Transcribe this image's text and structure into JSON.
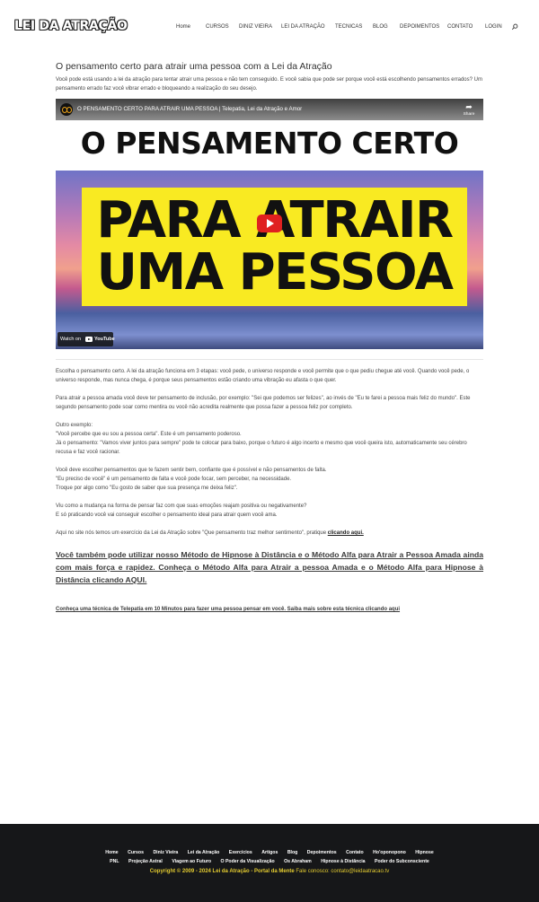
{
  "header": {
    "logo": "LEI DA ATRAÇÃO",
    "nav": [
      "Home",
      "CURSOS",
      "DINIZ VIEIRA",
      "LEI DA ATRAÇÃO",
      "TECNICAS",
      "BLOG",
      "DEPOIMENTOS",
      "CONTATO",
      "LOGIN"
    ],
    "search_icon": "search-icon"
  },
  "post": {
    "title": "O pensamento certo para atrair uma pessoa com a Lei da Atração",
    "intro": "Você pode está usando a lei da atração para tentar atrair uma pessoa e não tem conseguido. E você sabia que pode ser porque você está escolhendo pensamentos errados? Um pensamento errado faz você vibrar errado e bloqueando a realização do seu desejo.",
    "video": {
      "title": "O PENSAMENTO CERTO PARA ATRAIR UMA PESSOA | Telepatia, Lei da Atração e Amor",
      "share": "Share",
      "line1": "O PENSAMENTO CERTO",
      "line2": "PARA ATRAIR",
      "line3": "UMA PESSOA",
      "watch_on": "Watch on",
      "youtube": "YouTube"
    },
    "paragraphs": [
      "Escolha o pensamento certo. A lei da atração funciona em 3 etapas: você pede, o universo responde e você permite que o que pediu chegue até você. Quando você pede, o universo responde, mas nunca chega, é porque seus pensamentos estão criando uma vibração eu afasta o que quer.",
      "Para atrair a pessoa amada você deve ter pensamento de inclusão, por exemplo: \"Sei que podemos ser felizes\", ao invés de \"Eu te farei a pessoa mais feliz do mundo\". Este segundo pensamento pode soar como mentira ou você não acredita realmente que possa fazer a pessoa feliz por completo.",
      "Outro exemplo:",
      "\"Você percebe que eu sou a pessoa certa\". Este é um pensamento poderoso.",
      "Já o pensamento: \"Vamos viver juntos para sempre\" pode te colocar para baixo, porque o futuro é algo incerto e mesmo que você queira isto, automaticamente seu cérebro recusa e faz você racionar.",
      "Você deve escolher pensamentos que te fazem sentir bem, confiante que é possível e não pensamentos de falta.",
      "\"Eu preciso de você\" é um pensamento de falta e você pode focar, sem perceber, na necessidade.",
      "Troque por algo como \"Eu gosto de saber que sua presença me deixa feliz\".",
      "Viu como a mudança na forma de pensar faz com que suas emoções reajam positiva ou negativamente?",
      "E só praticando você vai conseguir escolher o pensamento ideal para atrair quem você ama.",
      "Aqui no site nós temos um exercício da Lei da Atração sobre \"Que pensamento traz melhor sentimento\", pratique"
    ],
    "inline_link": "clicando aqui.",
    "big_link": "Você também pode utilizar nosso Método de Hipnose à Distância e o Método Alfa para Atrair a Pessoa Amada ainda com mais força e rapidez. Conheça o Método Alfa para Atrair a pessoa Amada e o Método Alfa para Hipnose à Distância clicando AQUI.",
    "small_link": "Conheça uma técnica de Telepatia em 10 Minutos para fazer uma pessoa pensar em você. Saiba mais sobre esta técnica clicando aqui"
  },
  "footer": {
    "row1": [
      "Home",
      "Cursos",
      "Diniz Vieira",
      "Lei da Atração",
      "Exercícios",
      "Artigos",
      "Blog",
      "Depoimentos",
      "Contato",
      "Ho'oponopono",
      "Hipnose"
    ],
    "row2": [
      "PNL",
      "Projeção Astral",
      "Viagem ao Futuro",
      "O Poder da Visualização",
      "Os Abraham",
      "Hipnose à Distância",
      "Poder do Subconsciente"
    ],
    "copyright": "Copyright © 2009 - 2024 Lei da Atração - Portal da Mente",
    "contact": "Fale conosco: contato@leidaatracao.tv"
  },
  "colors": {
    "footer_bg": "#161719",
    "footer_copyright": "#e4cc30",
    "thumb_yellow": "#f9ea22",
    "play_red": "#e02020"
  }
}
